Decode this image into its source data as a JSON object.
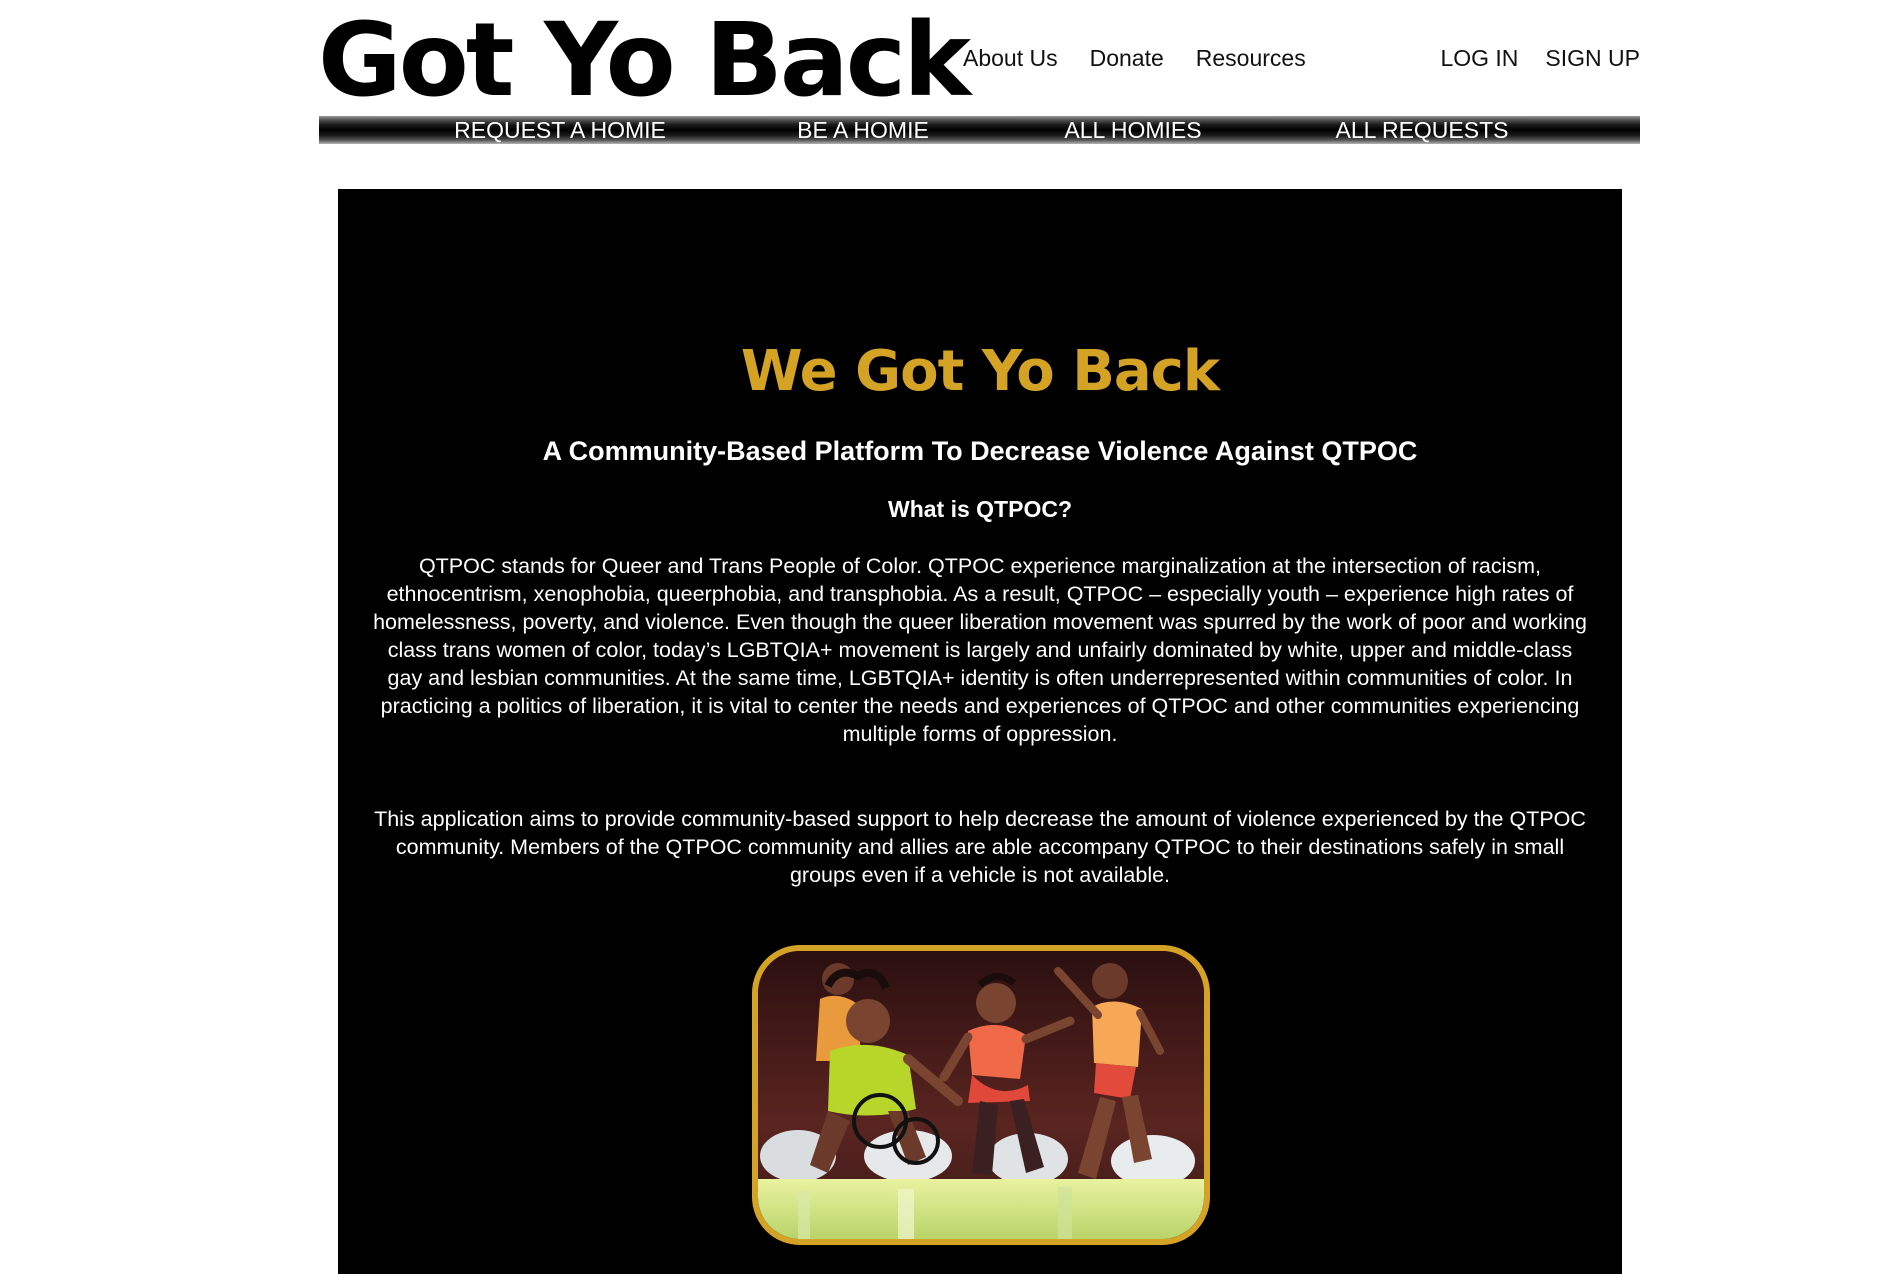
{
  "header": {
    "brand": "Got Yo Back",
    "nav": [
      "About Us",
      "Donate",
      "Resources"
    ],
    "auth": [
      "LOG IN",
      "SIGN UP"
    ]
  },
  "subnav": [
    "REQUEST A HOMIE",
    "BE A HOMIE",
    "ALL HOMIES",
    "ALL REQUESTS"
  ],
  "hero": {
    "title": "We Got Yo Back",
    "subtitle": "A Community-Based Platform To Decrease Violence Against QTPOC",
    "question": "What is QTPOC?",
    "paragraph1": "QTPOC stands for Queer and Trans People of Color. QTPOC experience marginalization at the intersection of racism, ethnocentrism, xenophobia, queerphobia, and transphobia. As a result, QTPOC – especially youth – experience high rates of homelessness, poverty, and violence. Even though the queer liberation movement was spurred by the work of poor and working class trans women of color, today’s LGBTQIA+ movement is largely and unfairly dominated by white, upper and middle-class gay and lesbian communities. At the same time, LGBTQIA+ identity is often underrepresented within communities of color. In practicing a politics of liberation, it is vital to center the needs and experiences of QTPOC and other communities experiencing multiple forms of oppression.",
    "paragraph2": "This application aims to provide community-based support to help decrease the amount of violence experienced by the QTPOC community. Members of the QTPOC community and allies are able accompany QTPOC to their destinations safely in small groups even if a vehicle is not available."
  },
  "colors": {
    "accent": "#d4a224",
    "panel_background": "#000000",
    "page_background": "#ffffff"
  }
}
